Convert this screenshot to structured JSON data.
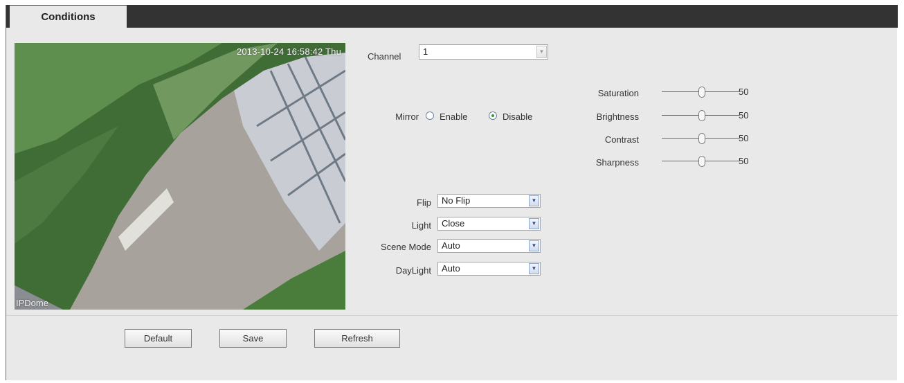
{
  "tabs": [
    {
      "label": "Conditions",
      "active": true
    }
  ],
  "preview": {
    "timestamp": "2013-10-24 16:58:42 Thu",
    "camera_name": "IPDome"
  },
  "channel": {
    "label": "Channel",
    "value": "1"
  },
  "mirror": {
    "label": "Mirror",
    "enable_label": "Enable",
    "disable_label": "Disable",
    "selected": "Disable"
  },
  "adjustments": [
    {
      "label": "Saturation",
      "value": "50"
    },
    {
      "label": "Brightness",
      "value": "50"
    },
    {
      "label": "Contrast",
      "value": "50"
    },
    {
      "label": "Sharpness",
      "value": "50"
    }
  ],
  "flip": {
    "label": "Flip",
    "value": "No Flip"
  },
  "light": {
    "label": "Light",
    "value": "Close"
  },
  "scene_mode": {
    "label": "Scene Mode",
    "value": "Auto"
  },
  "daylight": {
    "label": "DayLight",
    "value": "Auto"
  },
  "buttons": {
    "default": "Default",
    "save": "Save",
    "refresh": "Refresh"
  },
  "colors": {
    "tabbar": "#333333",
    "panel": "#e9e9e9",
    "radio_selected": "#2e9b3a"
  }
}
